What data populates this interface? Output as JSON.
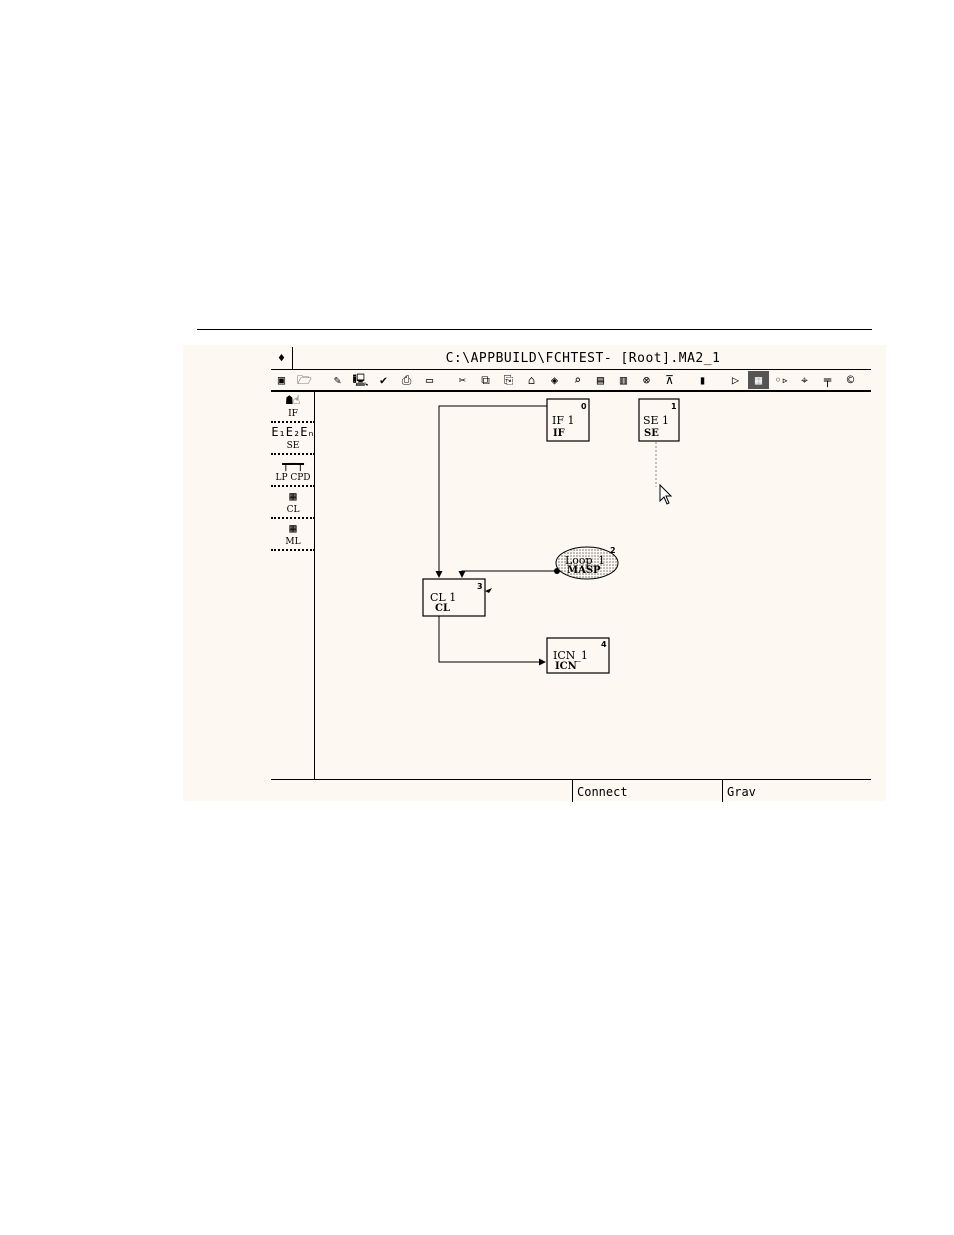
{
  "window": {
    "system_menu_glyph": "♦",
    "title": "C:\\APPBUILD\\FCHTEST- [Root].MA2_1"
  },
  "toolbar": [
    {
      "name": "save-icon",
      "glyph": "▣"
    },
    {
      "name": "open-folder-icon",
      "glyph": "🗁"
    },
    {
      "name": "sep"
    },
    {
      "name": "edit-pencil-icon",
      "glyph": "✎"
    },
    {
      "name": "monitor-icon",
      "glyph": "🖳"
    },
    {
      "name": "check-icon",
      "glyph": "✔"
    },
    {
      "name": "print-icon",
      "glyph": "⎙"
    },
    {
      "name": "text-box-icon",
      "glyph": "▭"
    },
    {
      "name": "sep"
    },
    {
      "name": "cut-icon",
      "glyph": "✂"
    },
    {
      "name": "copy-icon",
      "glyph": "⧉"
    },
    {
      "name": "paste-icon",
      "glyph": "⎘"
    },
    {
      "name": "lock-icon",
      "glyph": "⌂"
    },
    {
      "name": "diamond-icon",
      "glyph": "◈"
    },
    {
      "name": "zoom-icon",
      "glyph": "⌕"
    },
    {
      "name": "document-icon",
      "glyph": "▤"
    },
    {
      "name": "clipboard-icon",
      "glyph": "▥"
    },
    {
      "name": "group-icon",
      "glyph": "⊗"
    },
    {
      "name": "stamp-icon",
      "glyph": "⊼"
    },
    {
      "name": "sep"
    },
    {
      "name": "book-icon",
      "glyph": "▮"
    },
    {
      "name": "sep"
    },
    {
      "name": "pointer-icon",
      "glyph": "▷"
    },
    {
      "name": "connect-icon",
      "glyph": "▦",
      "active": true
    },
    {
      "name": "step-icon",
      "glyph": "◦▹"
    },
    {
      "name": "tree-icon",
      "glyph": "⌖"
    },
    {
      "name": "hierarchy-icon",
      "glyph": "╤"
    },
    {
      "name": "copyright-icon",
      "glyph": "©"
    }
  ],
  "palette": [
    {
      "name": "palette-if",
      "glyph": "☗☝",
      "label": "IF"
    },
    {
      "name": "palette-se",
      "glyph": "E₁E₂Eₙ",
      "label": "SE"
    },
    {
      "name": "palette-lp-cpd",
      "glyph": "┯━┯",
      "label": "LP CPD"
    },
    {
      "name": "palette-cl",
      "glyph": "▦",
      "label": "CL"
    },
    {
      "name": "palette-ml",
      "glyph": "▦",
      "label": "ML"
    }
  ],
  "blocks": {
    "if": {
      "name": "IF 1",
      "type": "IF",
      "number": "0"
    },
    "se": {
      "name": "SE 1",
      "type": "SE",
      "number": "1"
    },
    "loop": {
      "name": "Loop_1",
      "type": "MASP",
      "number": "2"
    },
    "cl": {
      "name": "CL 1",
      "type": "CL",
      "number": "3"
    },
    "icn": {
      "name": "ICN_1",
      "type": "ICN",
      "number": "4"
    }
  },
  "status": {
    "message": "",
    "mode": "Connect",
    "gravity": "Grav"
  }
}
